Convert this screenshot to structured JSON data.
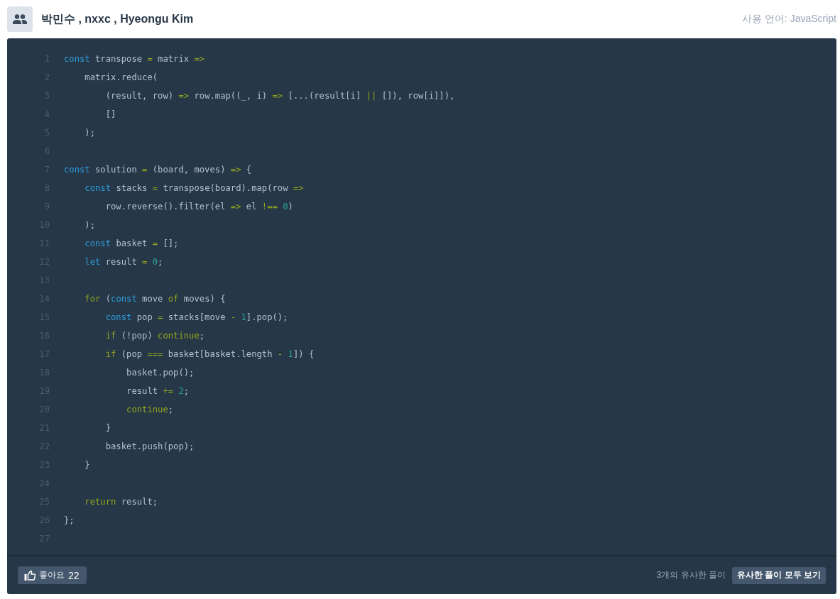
{
  "header": {
    "authors": "박민수 , nxxc , Hyeongu Kim",
    "language": "사용 언어: JavaScript"
  },
  "code": [
    {
      "number": "1",
      "tokens": [
        {
          "t": "const",
          "kind": "keyword"
        },
        {
          "t": " transpose ",
          "kind": "plain"
        },
        {
          "t": "=",
          "kind": "operator"
        },
        {
          "t": " matrix ",
          "kind": "plain"
        },
        {
          "t": "=>",
          "kind": "operator"
        }
      ]
    },
    {
      "number": "2",
      "tokens": [
        {
          "t": "    matrix.reduce(",
          "kind": "plain"
        }
      ]
    },
    {
      "number": "3",
      "tokens": [
        {
          "t": "        (result, row) ",
          "kind": "plain"
        },
        {
          "t": "=>",
          "kind": "operator"
        },
        {
          "t": " row.map((_, i) ",
          "kind": "plain"
        },
        {
          "t": "=>",
          "kind": "operator"
        },
        {
          "t": " [...(result[i] ",
          "kind": "plain"
        },
        {
          "t": "||",
          "kind": "operator"
        },
        {
          "t": " []), row[i]]),",
          "kind": "plain"
        }
      ]
    },
    {
      "number": "4",
      "tokens": [
        {
          "t": "        []",
          "kind": "plain"
        }
      ]
    },
    {
      "number": "5",
      "tokens": [
        {
          "t": "    );",
          "kind": "plain"
        }
      ]
    },
    {
      "number": "6"
    },
    {
      "number": "7",
      "tokens": [
        {
          "t": "const",
          "kind": "keyword"
        },
        {
          "t": " solution ",
          "kind": "plain"
        },
        {
          "t": "=",
          "kind": "operator"
        },
        {
          "t": " (board, moves) ",
          "kind": "plain"
        },
        {
          "t": "=>",
          "kind": "operator"
        },
        {
          "t": " {",
          "kind": "plain"
        }
      ]
    },
    {
      "number": "8",
      "tokens": [
        {
          "t": "    const",
          "kind": "keyword"
        },
        {
          "t": " stacks ",
          "kind": "plain"
        },
        {
          "t": "=",
          "kind": "operator"
        },
        {
          "t": " transpose(board).map(row ",
          "kind": "plain"
        },
        {
          "t": "=>",
          "kind": "operator"
        }
      ]
    },
    {
      "number": "9",
      "tokens": [
        {
          "t": "        row.reverse().filter(el ",
          "kind": "plain"
        },
        {
          "t": "=>",
          "kind": "operator"
        },
        {
          "t": " el ",
          "kind": "plain"
        },
        {
          "t": "!==",
          "kind": "operator"
        },
        {
          "t": " 0",
          "kind": "number"
        },
        {
          "t": ")",
          "kind": "plain"
        }
      ]
    },
    {
      "number": "10",
      "tokens": [
        {
          "t": "    );",
          "kind": "plain"
        }
      ]
    },
    {
      "number": "11",
      "tokens": [
        {
          "t": "    const",
          "kind": "keyword"
        },
        {
          "t": " basket ",
          "kind": "plain"
        },
        {
          "t": "=",
          "kind": "operator"
        },
        {
          "t": " [];",
          "kind": "plain"
        }
      ]
    },
    {
      "number": "12",
      "tokens": [
        {
          "t": "    let",
          "kind": "keyword"
        },
        {
          "t": " result ",
          "kind": "plain"
        },
        {
          "t": "=",
          "kind": "operator"
        },
        {
          "t": " 0",
          "kind": "number"
        },
        {
          "t": ";",
          "kind": "plain"
        }
      ]
    },
    {
      "number": "13"
    },
    {
      "number": "14",
      "tokens": [
        {
          "t": "    for",
          "kind": "control"
        },
        {
          "t": " (",
          "kind": "plain"
        },
        {
          "t": "const",
          "kind": "keyword"
        },
        {
          "t": " move ",
          "kind": "plain"
        },
        {
          "t": "of",
          "kind": "control"
        },
        {
          "t": " moves) {",
          "kind": "plain"
        }
      ]
    },
    {
      "number": "15",
      "tokens": [
        {
          "t": "        const",
          "kind": "keyword"
        },
        {
          "t": " pop ",
          "kind": "plain"
        },
        {
          "t": "=",
          "kind": "operator"
        },
        {
          "t": " stacks[move ",
          "kind": "plain"
        },
        {
          "t": "-",
          "kind": "operator"
        },
        {
          "t": " 1",
          "kind": "number"
        },
        {
          "t": "].pop();",
          "kind": "plain"
        }
      ]
    },
    {
      "number": "16",
      "tokens": [
        {
          "t": "        if",
          "kind": "control"
        },
        {
          "t": " (!pop) ",
          "kind": "plain"
        },
        {
          "t": "continue",
          "kind": "control"
        },
        {
          "t": ";",
          "kind": "plain"
        }
      ]
    },
    {
      "number": "17",
      "tokens": [
        {
          "t": "        if",
          "kind": "control"
        },
        {
          "t": " (pop ",
          "kind": "plain"
        },
        {
          "t": "===",
          "kind": "operator"
        },
        {
          "t": " basket[basket.length ",
          "kind": "plain"
        },
        {
          "t": "-",
          "kind": "operator"
        },
        {
          "t": " 1",
          "kind": "number"
        },
        {
          "t": "]) {",
          "kind": "plain"
        }
      ]
    },
    {
      "number": "18",
      "tokens": [
        {
          "t": "            basket.pop();",
          "kind": "plain"
        }
      ]
    },
    {
      "number": "19",
      "tokens": [
        {
          "t": "            result ",
          "kind": "plain"
        },
        {
          "t": "+=",
          "kind": "operator"
        },
        {
          "t": " 2",
          "kind": "number"
        },
        {
          "t": ";",
          "kind": "plain"
        }
      ]
    },
    {
      "number": "20",
      "tokens": [
        {
          "t": "            continue",
          "kind": "control"
        },
        {
          "t": ";",
          "kind": "plain"
        }
      ]
    },
    {
      "number": "21",
      "tokens": [
        {
          "t": "        }",
          "kind": "plain"
        }
      ]
    },
    {
      "number": "22",
      "tokens": [
        {
          "t": "        basket.push(pop);",
          "kind": "plain"
        }
      ]
    },
    {
      "number": "23",
      "tokens": [
        {
          "t": "    }",
          "kind": "plain"
        }
      ]
    },
    {
      "number": "24"
    },
    {
      "number": "25",
      "tokens": [
        {
          "t": "    return",
          "kind": "control"
        },
        {
          "t": " result;",
          "kind": "plain"
        }
      ]
    },
    {
      "number": "26",
      "tokens": [
        {
          "t": "};",
          "kind": "plain"
        }
      ]
    },
    {
      "number": "27"
    }
  ],
  "footer": {
    "like_label": "좋아요",
    "like_count": "22",
    "similar_count": "3개의 유사한 풀이",
    "similar_button": "유사한 풀이 모두 보기"
  }
}
